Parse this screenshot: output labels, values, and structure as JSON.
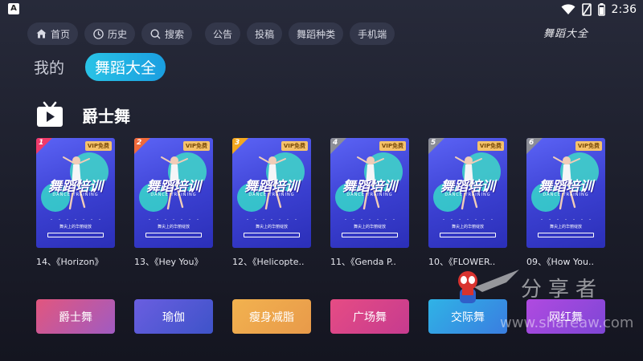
{
  "status_bar": {
    "left_icon": "A",
    "time": "2:36",
    "icons": [
      "wifi-icon",
      "no-sim-icon",
      "battery-icon"
    ]
  },
  "nav": {
    "home": "首页",
    "history": "历史",
    "search": "搜索",
    "notice": "公告",
    "submit": "投稿",
    "types": "舞蹈种类",
    "mobile": "手机端"
  },
  "app_logo": "舞蹈大全",
  "tabs": {
    "mine": "我的",
    "dance_all": "舞蹈大全"
  },
  "section": {
    "title": "爵士舞",
    "icon": "tv-play-icon"
  },
  "cards": [
    {
      "rank": "1",
      "caption": "14、《Horizon》",
      "vip": "VIP免费",
      "poster_title": "舞蹈培训",
      "poster_sub": "DANCE TRAINING",
      "rank_color": "#ee3a6b"
    },
    {
      "rank": "2",
      "caption": "13、《Hey You》",
      "vip": "VIP免费",
      "poster_title": "舞蹈培训",
      "poster_sub": "DANCE TRAINING",
      "rank_color": "#f06a3b"
    },
    {
      "rank": "3",
      "caption": "12、《Helicopte..",
      "vip": "VIP免费",
      "poster_title": "舞蹈培训",
      "poster_sub": "DANCE TRAINING",
      "rank_color": "#f3a81f"
    },
    {
      "rank": "4",
      "caption": "11、《Genda P..",
      "vip": "VIP免费",
      "poster_title": "舞蹈培训",
      "poster_sub": "DANCE TRAINING",
      "rank_color": "#8b8d96"
    },
    {
      "rank": "5",
      "caption": "10、《FLOWER..",
      "vip": "VIP免费",
      "poster_title": "舞蹈培训",
      "poster_sub": "DANCE TRAINING",
      "rank_color": "#8b8d96"
    },
    {
      "rank": "6",
      "caption": "09、《How You..",
      "vip": "VIP免费",
      "poster_title": "舞蹈培训",
      "poster_sub": "DANCE TRAINING",
      "rank_color": "#8b8d96"
    }
  ],
  "categories": [
    {
      "label": "爵士舞",
      "gradient": [
        "#e2567e",
        "#a05bc2"
      ]
    },
    {
      "label": "瑜伽",
      "gradient": [
        "#6a5ee0",
        "#3e53c9"
      ]
    },
    {
      "label": "瘦身减脂",
      "gradient": [
        "#f2b24f",
        "#e89a4a"
      ]
    },
    {
      "label": "广场舞",
      "gradient": [
        "#e64c84",
        "#c63b8f"
      ]
    },
    {
      "label": "交际舞",
      "gradient": [
        "#2fb3e6",
        "#3a7de0"
      ]
    },
    {
      "label": "网红舞",
      "gradient": [
        "#b04ae0",
        "#7e46d6"
      ]
    }
  ],
  "watermark": {
    "text": "分享者",
    "url": "www.shareaw.com"
  }
}
